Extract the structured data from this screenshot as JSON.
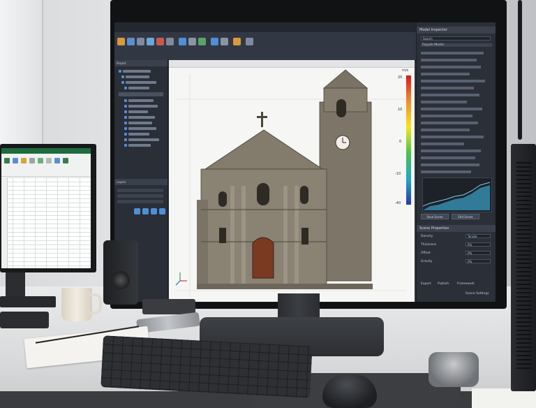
{
  "scene": {
    "description_tags": [
      "photo-icon",
      "monitor-icon",
      "keyboard-icon",
      "mouse-icon"
    ]
  },
  "colorbar": {
    "unit": "m/s",
    "ticks": [
      "20",
      "10",
      "0",
      "-10",
      "-40"
    ]
  },
  "left_panels": {
    "tree_header": "Project",
    "props_header": "Layers"
  },
  "right_panel": {
    "top_header": "Model Inspector",
    "search_placeholder": "Search",
    "selected_item": "Façade Model",
    "buttons": [
      "Save Scene",
      "Edit Scene"
    ],
    "bottom_header": "Scene Properties",
    "fields": [
      {
        "label": "Density",
        "value": "Tensile"
      },
      {
        "label": "Thickness",
        "value": "0%"
      },
      {
        "label": "Offset",
        "value": "0%"
      },
      {
        "label": "Gravity",
        "value": "0%"
      }
    ],
    "footer_items": [
      "Export",
      "Publish",
      "Framework"
    ],
    "footer_right": "Scene Settings"
  },
  "colors": {
    "cad_bg": "#2c3038",
    "accent_blue": "#4f8fd6",
    "excel_green": "#1f6b3f",
    "chart_fill": "#3aa3c9"
  }
}
